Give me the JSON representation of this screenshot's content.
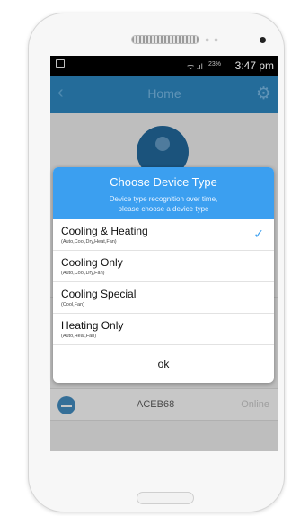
{
  "status_bar": {
    "battery": "23%",
    "time": "3:47 pm"
  },
  "app_bar": {
    "title": "Home"
  },
  "device": {
    "name": "ACEB68",
    "status": "Online"
  },
  "dialog": {
    "title": "Choose Device Type",
    "subtitle_line1": "Device type recognition over time,",
    "subtitle_line2": "please choose a device type",
    "options": [
      {
        "label": "Cooling & Heating",
        "modes": "(Auto,Cool,Dry,Heat,Fan)",
        "selected": true
      },
      {
        "label": "Cooling Only",
        "modes": "(Auto,Cool,Dry,Fan)",
        "selected": false
      },
      {
        "label": "Cooling Special",
        "modes": "(Cool,Fan)",
        "selected": false
      },
      {
        "label": "Heating Only",
        "modes": "(Auto,Heat,Fan)",
        "selected": false
      }
    ],
    "ok_label": "ok"
  }
}
